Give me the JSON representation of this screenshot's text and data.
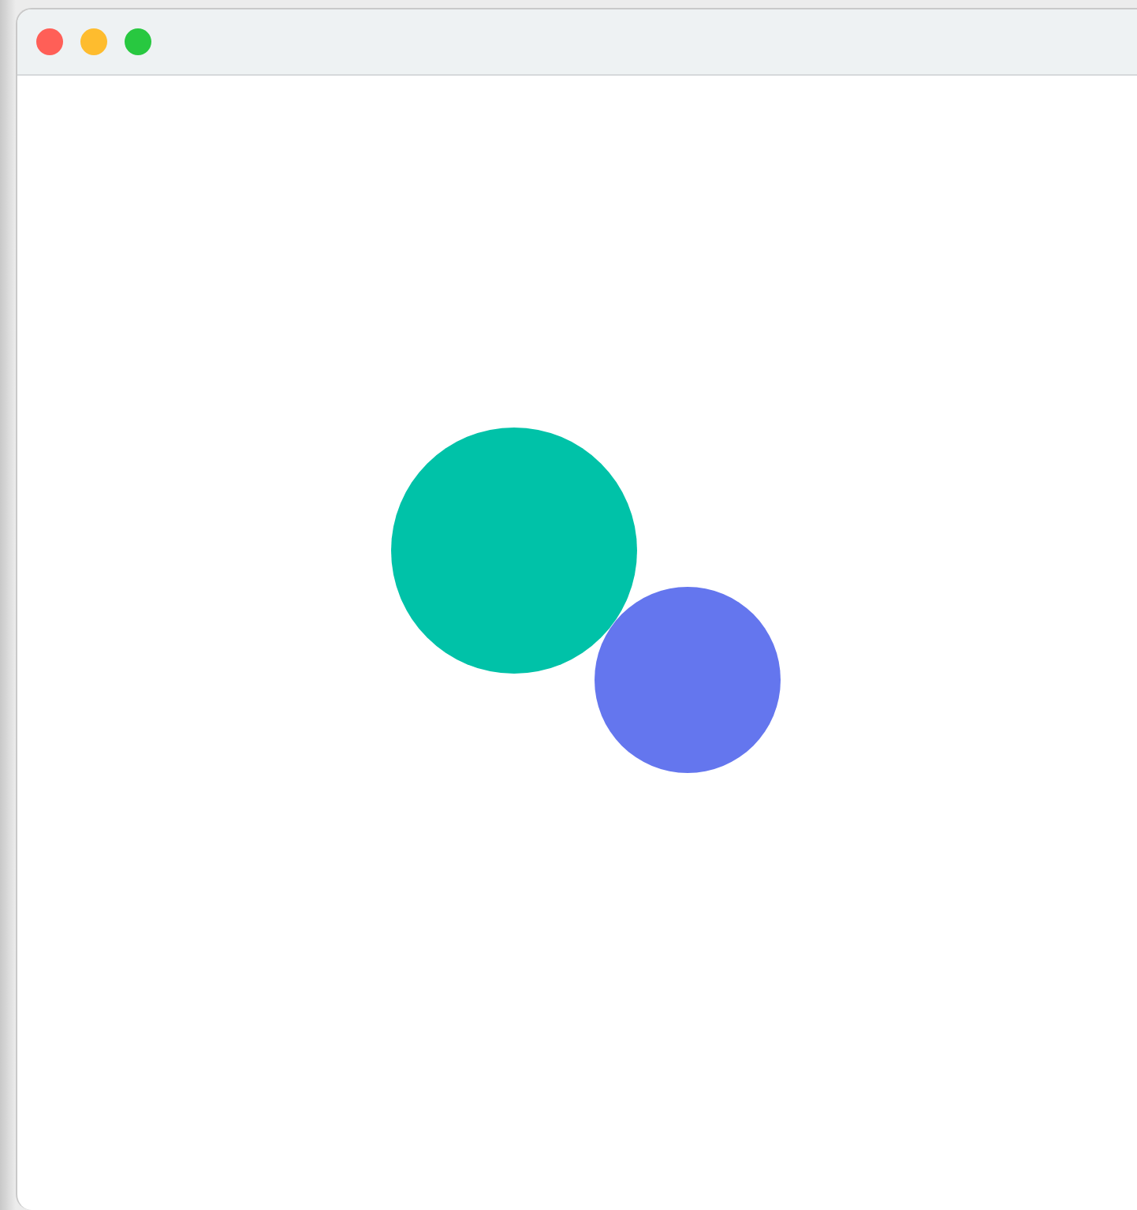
{
  "window": {
    "controls": [
      {
        "color": "#ff5f57"
      },
      {
        "color": "#febc2e"
      },
      {
        "color": "#28c840"
      }
    ]
  },
  "shapes": [
    {
      "color": "#00c2a8"
    },
    {
      "color": "#6476ee"
    }
  ]
}
